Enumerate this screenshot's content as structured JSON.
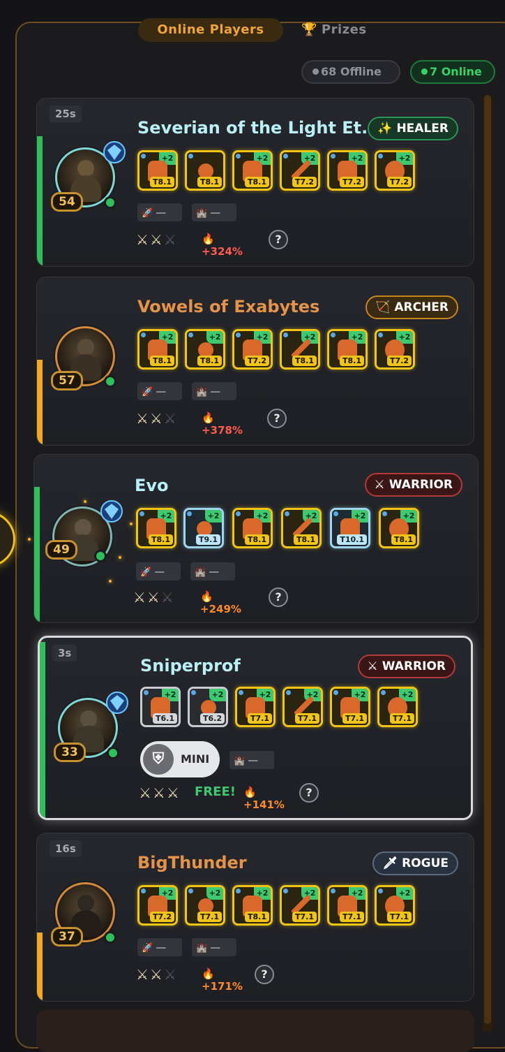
{
  "tabs": {
    "online": "Online Players",
    "prizes": "Prizes",
    "prizes_icon": "trophy-icon"
  },
  "counts": {
    "offline": "68 Offline",
    "online": "7 Online"
  },
  "colors": {
    "accent": "#f0a53a",
    "online_green": "#38d26a",
    "item_gold": "#f0c418",
    "item_blue": "#9fd6ee",
    "boost_red": "#ff5b4f"
  },
  "players": [
    {
      "timer": "25s",
      "name": "Severian of the Light Et...",
      "name_color": "#b8f0f5",
      "role": "HEALER",
      "role_icon": "sparkles-icon",
      "level": "54",
      "items": [
        {
          "tier": "T8.1",
          "plus": "+2"
        },
        {
          "tier": "T8.1",
          "plus": ""
        },
        {
          "tier": "T8.1",
          "plus": "+2"
        },
        {
          "tier": "T7.2",
          "plus": "+2"
        },
        {
          "tier": "T7.2",
          "plus": "+2"
        },
        {
          "tier": "T7.2",
          "plus": "+2"
        }
      ],
      "slot1": "—",
      "slot2": "—",
      "boost": "+324%"
    },
    {
      "timer": "",
      "name": "Vowels of Exabytes",
      "name_color": "#e4934a",
      "role": "ARCHER",
      "role_icon": "bow-icon",
      "level": "57",
      "items": [
        {
          "tier": "T8.1",
          "plus": "+2"
        },
        {
          "tier": "T8.1",
          "plus": "+2"
        },
        {
          "tier": "T7.2",
          "plus": "+2"
        },
        {
          "tier": "T8.1",
          "plus": "+2"
        },
        {
          "tier": "T8.1",
          "plus": "+2"
        },
        {
          "tier": "T7.2",
          "plus": "+2"
        }
      ],
      "slot1": "—",
      "slot2": "—",
      "boost": "+378%"
    },
    {
      "timer": "",
      "name": "Evo",
      "name_color": "#b8f0f5",
      "role": "WARRIOR",
      "role_icon": "crossed-swords-icon",
      "level": "49",
      "items": [
        {
          "tier": "T8.1",
          "plus": "+2"
        },
        {
          "tier": "T9.1",
          "plus": "+2"
        },
        {
          "tier": "T8.1",
          "plus": "+2"
        },
        {
          "tier": "T8.1",
          "plus": "+2"
        },
        {
          "tier": "T10.1",
          "plus": "+2"
        },
        {
          "tier": "T8.1",
          "plus": "+2"
        }
      ],
      "slot1": "—",
      "slot2": "—",
      "boost": "+249%"
    },
    {
      "timer": "3s",
      "name": "Sniperprof",
      "name_color": "#b8f0f5",
      "role": "WARRIOR",
      "role_icon": "crossed-swords-icon",
      "level": "33",
      "items": [
        {
          "tier": "T6.1",
          "plus": "+2"
        },
        {
          "tier": "T6.2",
          "plus": "+2"
        },
        {
          "tier": "T7.1",
          "plus": "+2"
        },
        {
          "tier": "T7.1",
          "plus": "+2"
        },
        {
          "tier": "T7.1",
          "plus": "+2"
        },
        {
          "tier": "T7.1",
          "plus": "+2"
        }
      ],
      "mini": "MINI",
      "slot2": "—",
      "free": "FREE!",
      "boost": "+141%"
    },
    {
      "timer": "16s",
      "name": "BigThunder",
      "name_color": "#e4934a",
      "role": "ROGUE",
      "role_icon": "dagger-icon",
      "level": "37",
      "items": [
        {
          "tier": "T7.2",
          "plus": "+2"
        },
        {
          "tier": "T7.1",
          "plus": "+2"
        },
        {
          "tier": "T8.1",
          "plus": "+2"
        },
        {
          "tier": "T7.1",
          "plus": "+2"
        },
        {
          "tier": "T7.1",
          "plus": "+2"
        },
        {
          "tier": "T7.1",
          "plus": "+2"
        }
      ],
      "slot1": "—",
      "slot2": "—",
      "boost": "+171%"
    }
  ],
  "help_label": "?"
}
